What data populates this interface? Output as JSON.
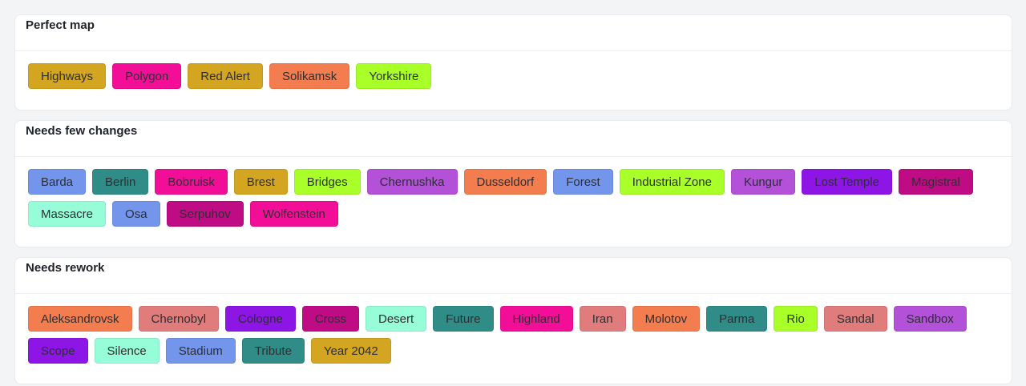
{
  "sections": [
    {
      "title": "Perfect map",
      "rows": [
        [
          {
            "label": "Highways",
            "color": "#d4a520"
          },
          {
            "label": "Polygon",
            "color": "#f20e96"
          },
          {
            "label": "Red Alert",
            "color": "#d4a520"
          },
          {
            "label": "Solikamsk",
            "color": "#f37d4f"
          },
          {
            "label": "Yorkshire",
            "color": "#a9ff28"
          }
        ]
      ]
    },
    {
      "title": "Needs few changes",
      "rows": [
        [
          {
            "label": "Barda",
            "color": "#7396ec"
          },
          {
            "label": "Berlin",
            "color": "#2f8c87"
          },
          {
            "label": "Bobruisk",
            "color": "#f20e96"
          },
          {
            "label": "Brest",
            "color": "#d4a520"
          },
          {
            "label": "Bridges",
            "color": "#a9ff28"
          },
          {
            "label": "Chernushka",
            "color": "#b352d8"
          },
          {
            "label": "Dusseldorf",
            "color": "#f37d4f"
          },
          {
            "label": "Forest",
            "color": "#7396ec"
          },
          {
            "label": "Industrial Zone",
            "color": "#a9ff28"
          },
          {
            "label": "Kungur",
            "color": "#b352d8"
          },
          {
            "label": "Lost Temple",
            "color": "#8d16e6"
          },
          {
            "label": "Magistral",
            "color": "#bf0c85"
          }
        ],
        [
          {
            "label": "Massacre",
            "color": "#97fdd8"
          },
          {
            "label": "Osa",
            "color": "#7396ec"
          },
          {
            "label": "Serpuhov",
            "color": "#bf0c85"
          },
          {
            "label": "Wolfenstein",
            "color": "#f20e96"
          }
        ]
      ]
    },
    {
      "title": "Needs rework",
      "rows": [
        [
          {
            "label": "Aleksandrovsk",
            "color": "#f37d4f"
          },
          {
            "label": "Chernobyl",
            "color": "#e17c7c"
          },
          {
            "label": "Cologne",
            "color": "#8d16e6"
          },
          {
            "label": "Cross",
            "color": "#bf0c85"
          },
          {
            "label": "Desert",
            "color": "#97fdd8"
          },
          {
            "label": "Future",
            "color": "#2f8c87"
          },
          {
            "label": "Highland",
            "color": "#f20e96"
          },
          {
            "label": "Iran",
            "color": "#e17c7c"
          },
          {
            "label": "Molotov",
            "color": "#f37d4f"
          },
          {
            "label": "Parma",
            "color": "#2f8c87"
          },
          {
            "label": "Rio",
            "color": "#a9ff28"
          },
          {
            "label": "Sandal",
            "color": "#e17c7c"
          },
          {
            "label": "Sandbox",
            "color": "#b352d8"
          }
        ],
        [
          {
            "label": "Scope",
            "color": "#8d16e6"
          },
          {
            "label": "Silence",
            "color": "#97fdd8"
          },
          {
            "label": "Stadium",
            "color": "#7396ec"
          },
          {
            "label": "Tribute",
            "color": "#2f8c87"
          },
          {
            "label": "Year 2042",
            "color": "#d4a520"
          }
        ]
      ]
    }
  ]
}
